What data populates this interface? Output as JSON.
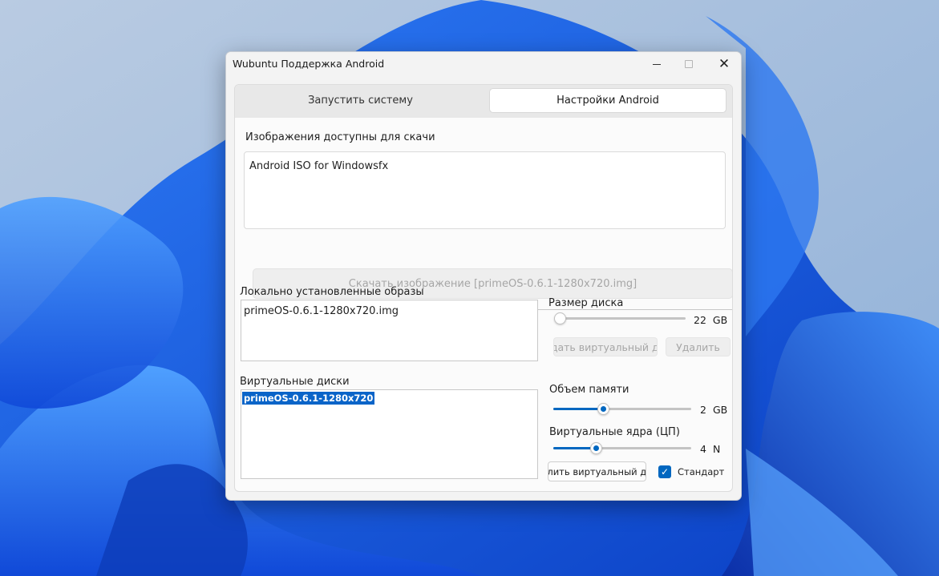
{
  "colors": {
    "accent": "#0067c0",
    "selection": "#0a64c8",
    "disabled_text": "#a6a6a6"
  },
  "window": {
    "title": "Wubuntu Поддержка Android"
  },
  "tabs": [
    {
      "label": "Запустить систему",
      "active": false
    },
    {
      "label": "Настройки Android",
      "active": true
    }
  ],
  "download": {
    "section_label": "Изображения доступны для скачи",
    "items": [
      "Android ISO for Windowsfx"
    ],
    "button_label": "Скачать изображение [primeOS-0.6.1-1280x720.img]"
  },
  "local_images": {
    "label": "Локально установленные образы",
    "items": [
      "primeOS-0.6.1-1280x720.img"
    ]
  },
  "virtual_disks": {
    "label": "Виртуальные диски",
    "items": [
      "primeOS-0.6.1-1280x720"
    ],
    "selected_index": 0
  },
  "disk_size": {
    "label": "Размер диска",
    "value": "22",
    "unit": "GB",
    "level": 0.0,
    "create_button": "здать виртуальный ди",
    "delete_button": "Удалить"
  },
  "memory": {
    "label": "Объем памяти",
    "value": "2",
    "unit": "GB",
    "level": 0.35
  },
  "cores": {
    "label": "Виртуальные ядра (ЦП)",
    "value": "4",
    "unit": "N",
    "level": 0.29
  },
  "bottom": {
    "delete_disk_button": "алить виртуальный ди",
    "default_checkbox_label": "Стандарт",
    "default_checked": true
  }
}
